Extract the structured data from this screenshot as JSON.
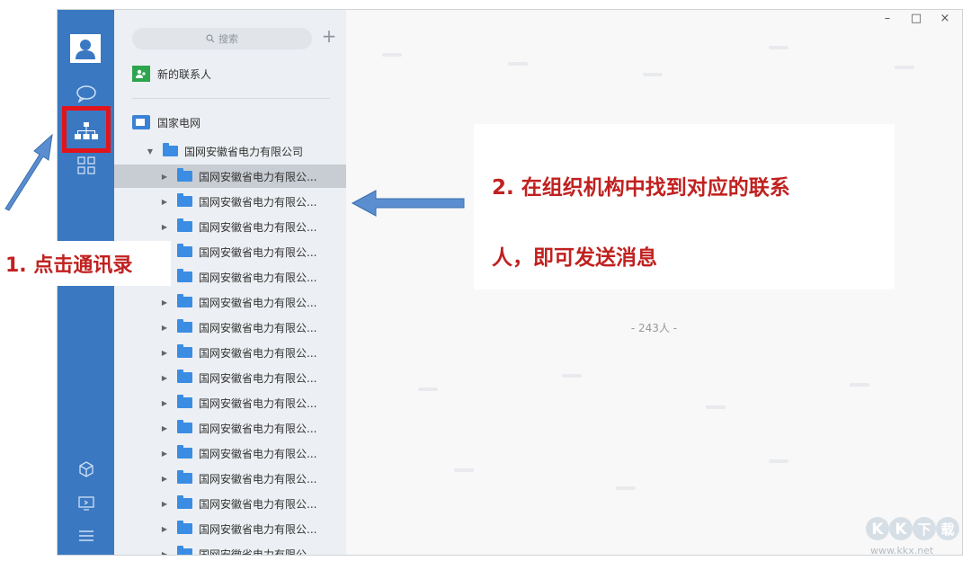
{
  "contacts_panel": {
    "search_placeholder": "搜索",
    "add_label": "+",
    "new_contact_label": "新的联系人",
    "org_root": "国家电网",
    "org_company": "国网安徽省电力有限公司",
    "sub_units": [
      "国网安徽省电力有限公...",
      "国网安徽省电力有限公...",
      "国网安徽省电力有限公...",
      "国网安徽省电力有限公...",
      "国网安徽省电力有限公...",
      "国网安徽省电力有限公...",
      "国网安徽省电力有限公...",
      "国网安徽省电力有限公...",
      "国网安徽省电力有限公...",
      "国网安徽省电力有限公...",
      "国网安徽省电力有限公...",
      "国网安徽省电力有限公...",
      "国网安徽省电力有限公...",
      "国网安徽省电力有限公...",
      "国网安徽省电力有限公...",
      "国网安徽省电力有限公..."
    ]
  },
  "main": {
    "member_count": "- 243人 -"
  },
  "window_controls": {
    "minimize": "–",
    "maximize": "□",
    "close": "×"
  },
  "annotations": {
    "step1": "1. 点击通讯录",
    "step2_line1": "2. 在组织机构中找到对应的联系",
    "step2_line2": "人，即可发送消息"
  },
  "watermark": {
    "logo_text": "KK下载",
    "url": "www.kkx.net"
  },
  "colors": {
    "rail": "#3a78c2",
    "accent_red": "#c0211f",
    "folder_blue": "#3b8de3",
    "new_contact_green": "#2ea44f"
  }
}
